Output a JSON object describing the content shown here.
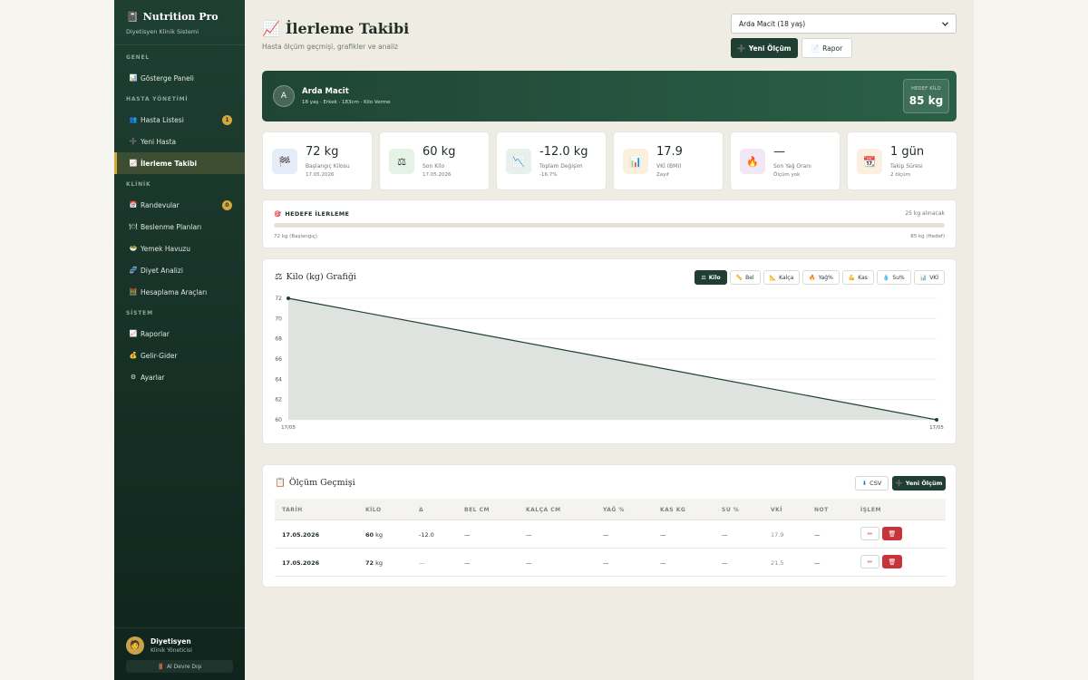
{
  "sidebar": {
    "brand_icon": "📓",
    "brand": "Nutrition Pro",
    "brand_sub": "Diyetisyen Klinik Sistemi",
    "sections": {
      "general": "GENEL",
      "patients": "HASTA YÖNETİMİ",
      "clinic": "KLİNİK",
      "system": "SİSTEM"
    },
    "items": {
      "dashboard": {
        "icon": "📊",
        "label": "Gösterge Paneli"
      },
      "patient_list": {
        "icon": "👥",
        "label": "Hasta Listesi",
        "badge": "1"
      },
      "new_patient": {
        "icon": "➕",
        "label": "Yeni Hasta"
      },
      "progress": {
        "icon": "📈",
        "label": "İlerleme Takibi"
      },
      "appointments": {
        "icon": "📅",
        "label": "Randevular",
        "badge": "0"
      },
      "nutrition_plans": {
        "icon": "🍽",
        "label": "Beslenme Planları"
      },
      "food_pool": {
        "icon": "🥗",
        "label": "Yemek Havuzu"
      },
      "diet_analysis": {
        "icon": "🧬",
        "label": "Diyet Analizi"
      },
      "calc_tools": {
        "icon": "🧮",
        "label": "Hesaplama Araçları"
      },
      "reports": {
        "icon": "📈",
        "label": "Raporlar"
      },
      "income": {
        "icon": "💰",
        "label": "Gelir-Gider"
      },
      "settings": {
        "icon": "⚙",
        "label": "Ayarlar"
      }
    },
    "user": {
      "avatar": "🧑",
      "name": "Diyetisyen",
      "role": "Klinik Yöneticisi",
      "logout_icon": "🚪",
      "logout": "Al Devre Dışı"
    }
  },
  "header": {
    "title_icon": "📈",
    "title": "İlerleme Takibi",
    "subtitle": "Hasta ölçüm geçmişi, grafikler ve analiz",
    "patient_select": "Arda Macit (18 yaş)",
    "new_measure_icon": "➕",
    "new_measure": "Yeni Ölçüm",
    "report_icon": "📄",
    "report": "Rapor"
  },
  "patient": {
    "initial": "A",
    "name": "Arda Macit",
    "meta": "18 yaş · Erkek · 183cm · Kilo Verme",
    "goal_label": "HEDEF KİLO",
    "goal_value": "85 kg"
  },
  "stats": [
    {
      "icon": "🏁",
      "value": "72 kg",
      "label": "Başlangıç Kilosu",
      "sub": "17.05.2026",
      "bg": "#e4edf8"
    },
    {
      "icon": "⚖",
      "value": "60 kg",
      "label": "Son Kilo",
      "sub": "17.05.2026",
      "bg": "#e5f2e6"
    },
    {
      "icon": "📉",
      "value": "-12.0 kg",
      "label": "Toplam Değişim",
      "sub": "-16.7%",
      "bg": "#e8f0ec"
    },
    {
      "icon": "📊",
      "value": "17.9",
      "label": "VKİ (BMI)",
      "sub": "Zayıf",
      "bg": "#fbf0dd"
    },
    {
      "icon": "🔥",
      "value": "—",
      "label": "Son Yağ Oranı",
      "sub": "Ölçüm yok",
      "bg": "#f2e7f5"
    },
    {
      "icon": "📆",
      "value": "1 gün",
      "label": "Takip Süresi",
      "sub": "2 ölçüm",
      "bg": "#fbefe0"
    }
  ],
  "progress": {
    "icon": "🎯",
    "title": "HEDEFE İLERLEME",
    "remaining": "25 kg alınacak",
    "start_label": "72 kg (Başlangıç)",
    "goal_label": "85 kg (Hedef)",
    "fraction": 0.0
  },
  "chart_tabs": [
    {
      "icon": "⚖",
      "label": "Kilo",
      "active": true
    },
    {
      "icon": "📏",
      "label": "Bel"
    },
    {
      "icon": "📐",
      "label": "Kalça"
    },
    {
      "icon": "🔥",
      "label": "Yağ%"
    },
    {
      "icon": "💪",
      "label": "Kas"
    },
    {
      "icon": "💧",
      "label": "Su%"
    },
    {
      "icon": "📊",
      "label": "VKİ"
    }
  ],
  "chart_data": {
    "type": "area",
    "title": "Kilo (kg) Grafiği",
    "title_icon": "⚖",
    "x": [
      "17/05",
      "17/05"
    ],
    "series": [
      {
        "values": [
          72,
          60
        ]
      }
    ],
    "yticks": [
      60,
      62,
      64,
      66,
      68,
      70,
      72
    ],
    "ylim": [
      60,
      72
    ],
    "grid": true,
    "line_color": "#1f3f33",
    "fill_color": "#dfe3df"
  },
  "table": {
    "icon": "📋",
    "title": "Ölçüm Geçmişi",
    "csv_icon": "⬇",
    "csv": "CSV",
    "new_icon": "➕",
    "new": "Yeni Ölçüm",
    "headers": [
      "TARİH",
      "KİLO",
      "Δ",
      "BEL CM",
      "KALÇA CM",
      "YAĞ %",
      "KAS KG",
      "SU %",
      "VKİ",
      "NOT",
      "İŞLEM"
    ],
    "rows": [
      {
        "date": "17.05.2026",
        "kilo": "60",
        "unit": "kg",
        "delta": "-12.0",
        "bel": "—",
        "kalca": "—",
        "yag": "—",
        "kas": "—",
        "su": "—",
        "vki": "17.9",
        "not": "—"
      },
      {
        "date": "17.05.2026",
        "kilo": "72",
        "unit": "kg",
        "delta": "—",
        "bel": "—",
        "kalca": "—",
        "yag": "—",
        "kas": "—",
        "su": "—",
        "vki": "21.5",
        "not": "—"
      }
    ],
    "edit_icon": "✏",
    "delete_icon": "🗑"
  }
}
